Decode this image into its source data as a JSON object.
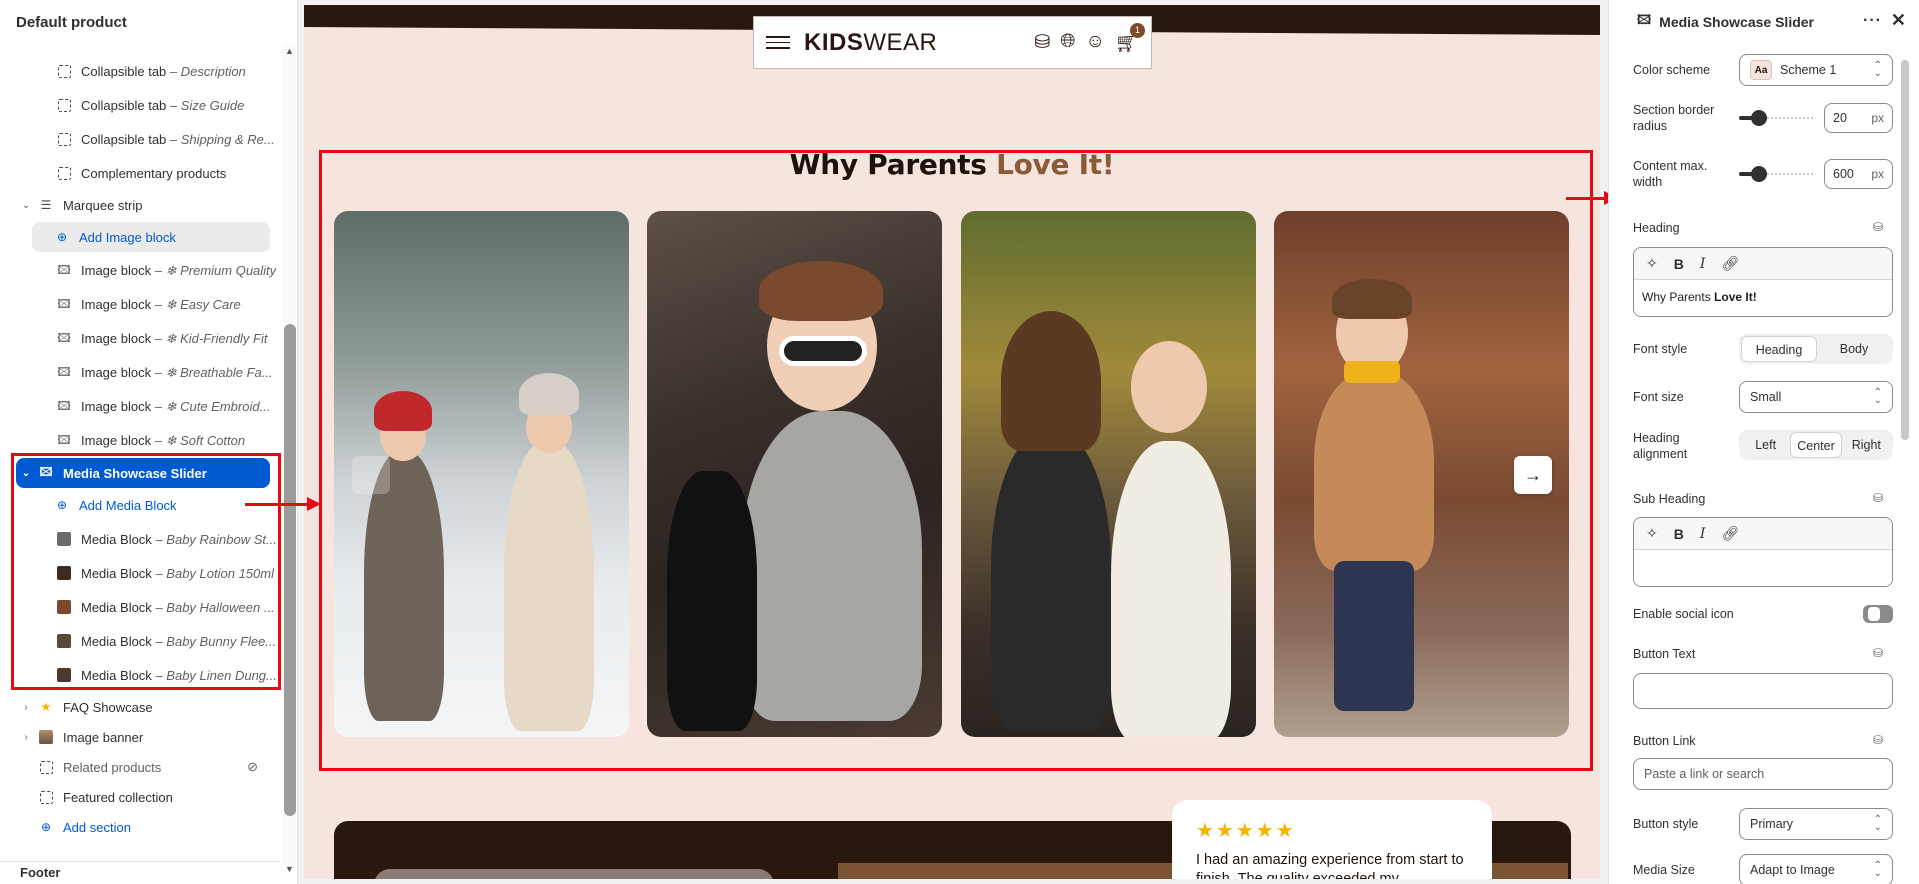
{
  "sidebar": {
    "title": "Default product",
    "items": [
      {
        "type": "Collapsible tab",
        "name": "Description"
      },
      {
        "type": "Collapsible tab",
        "name": "Size Guide"
      },
      {
        "type": "Collapsible tab",
        "name": "Shipping & Re..."
      },
      {
        "type": "Complementary products",
        "name": ""
      }
    ],
    "marquee_label": "Marquee strip",
    "add_image_block": "Add Image block",
    "image_blocks": [
      {
        "type": "Image block",
        "name": "❄ Premium Quality"
      },
      {
        "type": "Image block",
        "name": "❄ Easy Care"
      },
      {
        "type": "Image block",
        "name": "❄ Kid-Friendly Fit"
      },
      {
        "type": "Image block",
        "name": "❄ Breathable Fa..."
      },
      {
        "type": "Image block",
        "name": "❄ Cute Embroid..."
      },
      {
        "type": "Image block",
        "name": "❄ Soft Cotton"
      }
    ],
    "selected_section": "Media Showcase Slider",
    "add_media_block": "Add Media Block",
    "media_blocks": [
      {
        "type": "Media Block",
        "name": "Baby Rainbow St...",
        "color": "#6b6b6b"
      },
      {
        "type": "Media Block",
        "name": "Baby Lotion 150ml",
        "color": "#3a2a22"
      },
      {
        "type": "Media Block",
        "name": "Baby Halloween ...",
        "color": "#7a4a2a"
      },
      {
        "type": "Media Block",
        "name": "Baby Bunny Flee...",
        "color": "#5a4a3a"
      },
      {
        "type": "Media Block",
        "name": "Baby Linen Dung...",
        "color": "#4a3a32"
      }
    ],
    "dash": "–",
    "faq": "FAQ Showcase",
    "image_banner": "Image banner",
    "related": "Related products",
    "featured": "Featured collection",
    "add_section": "Add section",
    "footer": "Footer"
  },
  "preview": {
    "logo_bold": "KIDS",
    "logo_light": "WEAR",
    "cart_count": "1",
    "heading_main": "Why Parents ",
    "heading_accent": "Love It!",
    "next_arrow": "→",
    "stars": "★★★★★",
    "testimonial": "I had an amazing experience from start to finish. The quality exceeded my"
  },
  "panel": {
    "title": "Media Showcase Slider",
    "more": "···",
    "close": "✕",
    "color_scheme_label": "Color scheme",
    "color_scheme_value": "Scheme 1",
    "scheme_swatch": "Aa",
    "border_radius_label": "Section border radius",
    "border_radius_value": "20",
    "border_radius_fraction": 0.2,
    "content_width_label": "Content max. width",
    "content_width_value": "600",
    "content_width_fraction": 0.2,
    "unit_px": "px",
    "heading_label": "Heading",
    "heading_text_plain": "Why Parents ",
    "heading_text_bold": "Love It!",
    "font_style_label": "Font style",
    "font_style_options": [
      "Heading",
      "Body"
    ],
    "font_size_label": "Font size",
    "font_size_value": "Small",
    "heading_alignment_label": "Heading alignment",
    "alignment_options": [
      "Left",
      "Center",
      "Right"
    ],
    "sub_heading_label": "Sub Heading",
    "social_label": "Enable social icon",
    "button_text_label": "Button Text",
    "button_link_label": "Button Link",
    "button_link_placeholder": "Paste a link or search",
    "button_style_label": "Button style",
    "button_style_value": "Primary",
    "media_size_label": "Media Size",
    "media_size_value": "Adapt to Image"
  },
  "colors": {
    "accent_blue": "#005bd3",
    "annotation_red": "#e50914",
    "brand_dark": "#2a1710",
    "brand_accent": "#8b5a36",
    "canvas_bg": "#f6e4de"
  }
}
